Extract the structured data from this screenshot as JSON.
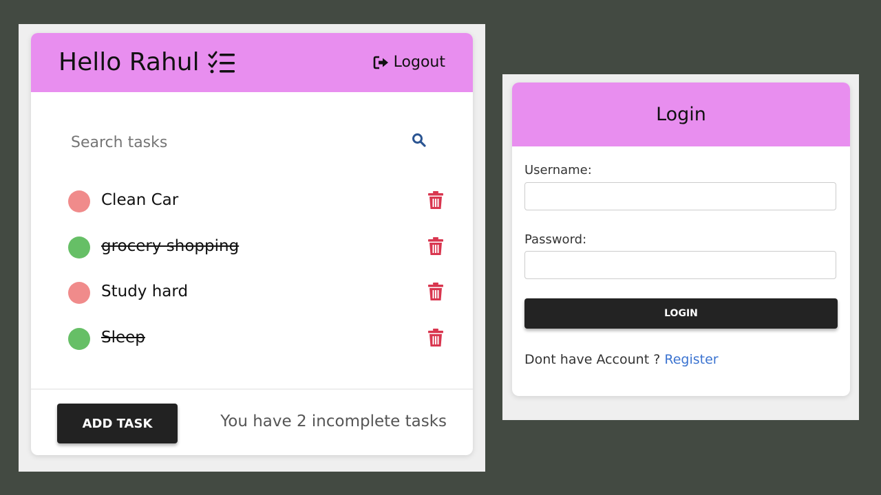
{
  "todo": {
    "greeting": "Hello Rahul",
    "logout_label": "Logout",
    "search_placeholder": "Search tasks",
    "tasks": [
      {
        "label": "Clean Car",
        "completed": false
      },
      {
        "label": "grocery shopping",
        "completed": true
      },
      {
        "label": "Study hard",
        "completed": false
      },
      {
        "label": "Sleep",
        "completed": true
      }
    ],
    "add_task_label": "ADD TASK",
    "status_text": "You have 2 incomplete tasks"
  },
  "login": {
    "title": "Login",
    "username_label": "Username:",
    "username_value": "",
    "password_label": "Password:",
    "password_value": "",
    "login_button": "LOGIN",
    "register_prompt": "Dont have Account ?",
    "register_link": "Register"
  },
  "colors": {
    "header": "#e88eef",
    "incomplete_dot": "#f08b8b",
    "complete_dot": "#66bf66",
    "trash": "#d9364f",
    "search_icon": "#2b5592",
    "link": "#3b73d0",
    "button": "#222222"
  },
  "icons": {
    "greeting_icon": "checklist-icon",
    "logout_icon": "logout-icon",
    "search_icon": "search-icon",
    "delete_icon": "trash-icon"
  }
}
